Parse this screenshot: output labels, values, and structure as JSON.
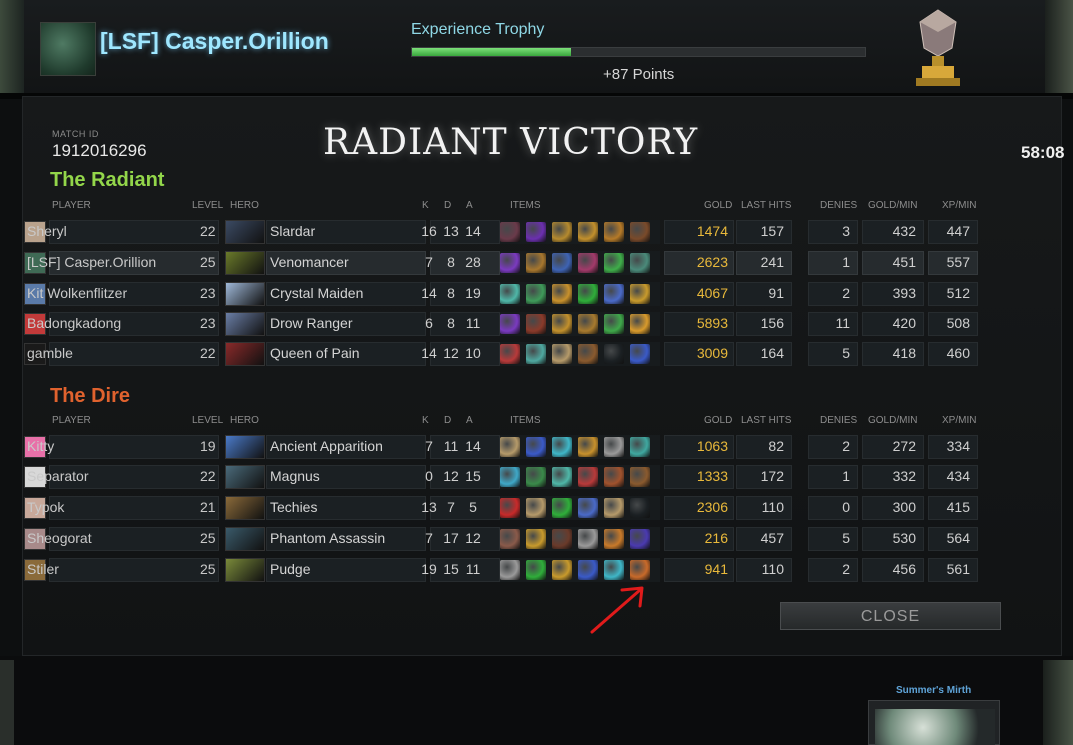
{
  "profile": {
    "player_name": "[LSF] Casper.Orillion",
    "xp_title": "Experience Trophy",
    "xp_progress_fraction": 0.35,
    "xp_points": "+87 Points"
  },
  "match": {
    "id_label": "MATCH ID",
    "id": "1912016296",
    "result": "RADIANT VICTORY",
    "duration": "58:08"
  },
  "headers": {
    "player": "PLAYER",
    "level": "LEVEL",
    "hero": "HERO",
    "k": "K",
    "d": "D",
    "a": "A",
    "items": "ITEMS",
    "gold": "GOLD",
    "last_hits": "LAST HITS",
    "denies": "DENIES",
    "gpm": "GOLD/MIN",
    "xpm": "XP/MIN"
  },
  "radiant": {
    "title": "The Radiant",
    "players": [
      {
        "name": "Sheryl",
        "level": "22",
        "hero": "Slardar",
        "k": "16",
        "d": "13",
        "a": "14",
        "gold": "1474",
        "lh": "157",
        "dn": "3",
        "gpm": "432",
        "xpm": "447",
        "avatar_color": "#b9a28c",
        "hero_color": "#3b4a63",
        "items": [
          "#6a3a4a",
          "#6b2fb0",
          "#b58a2e",
          "#c2902c",
          "#b57a28",
          "#7a4a2a"
        ]
      },
      {
        "name": "[LSF] Casper.Orillion",
        "level": "25",
        "hero": "Venomancer",
        "k": "7",
        "d": "8",
        "a": "28",
        "gold": "2623",
        "lh": "241",
        "dn": "1",
        "gpm": "451",
        "xpm": "557",
        "avatar_color": "#3f6a55",
        "hero_color": "#6a7a2a",
        "items": [
          "#7b3ac0",
          "#a7772e",
          "#3e63b3",
          "#a23a6a",
          "#3fae4a",
          "#4a8a7a"
        ]
      },
      {
        "name": "Kit Wolkenflitzer",
        "level": "23",
        "hero": "Crystal Maiden",
        "k": "14",
        "d": "8",
        "a": "19",
        "gold": "4067",
        "lh": "91",
        "dn": "2",
        "gpm": "393",
        "xpm": "512",
        "avatar_color": "#5a7aa8",
        "hero_color": "#9fb8d8",
        "items": [
          "#4fb7a8",
          "#3f9a5a",
          "#c8912c",
          "#2fae3a",
          "#4a6ac8",
          "#c89a2c"
        ]
      },
      {
        "name": "Badongkadong",
        "level": "23",
        "hero": "Drow Ranger",
        "k": "6",
        "d": "8",
        "a": "11",
        "gold": "5893",
        "lh": "156",
        "dn": "11",
        "gpm": "420",
        "xpm": "508",
        "avatar_color": "#c23a3a",
        "hero_color": "#6a7ea6",
        "items": [
          "#7a3ac0",
          "#8a3a2a",
          "#c2902c",
          "#a87a2e",
          "#3fa84a",
          "#d89a2c"
        ]
      },
      {
        "name": "gamble",
        "level": "22",
        "hero": "Queen of Pain",
        "k": "14",
        "d": "12",
        "a": "10",
        "gold": "3009",
        "lh": "164",
        "dn": "5",
        "gpm": "418",
        "xpm": "460",
        "avatar_color": "#1a1a1a",
        "hero_color": "#8a2a2a",
        "items": [
          "#b83a3a",
          "#4fa8a0",
          "#b59a6a",
          "#8a5a2e",
          "#1b2023",
          "#3a5ac8"
        ]
      }
    ]
  },
  "dire": {
    "title": "The Dire",
    "players": [
      {
        "name": "Kitty",
        "level": "19",
        "hero": "Ancient Apparition",
        "k": "7",
        "d": "11",
        "a": "14",
        "gold": "1063",
        "lh": "82",
        "dn": "2",
        "gpm": "272",
        "xpm": "334",
        "avatar_color": "#e870a8",
        "hero_color": "#4a7ac8",
        "items": [
          "#b59a6a",
          "#3a5ac8",
          "#3fb7c8",
          "#c8912c",
          "#9a9a9a",
          "#3fa8a0"
        ]
      },
      {
        "name": "Separator",
        "level": "22",
        "hero": "Magnus",
        "k": "0",
        "d": "12",
        "a": "15",
        "gold": "1333",
        "lh": "172",
        "dn": "1",
        "gpm": "332",
        "xpm": "434",
        "avatar_color": "#d8d8d8",
        "hero_color": "#4a6a7a",
        "items": [
          "#3fa8c8",
          "#3a8a4a",
          "#4fb7a8",
          "#b83a3a",
          "#a0522d",
          "#8a5a2e"
        ]
      },
      {
        "name": "Typok",
        "level": "21",
        "hero": "Techies",
        "k": "13",
        "d": "7",
        "a": "5",
        "gold": "2306",
        "lh": "110",
        "dn": "0",
        "gpm": "300",
        "xpm": "415",
        "avatar_color": "#c8a89a",
        "hero_color": "#8a6a3a",
        "items": [
          "#c82a2a",
          "#b59a6a",
          "#2fae3a",
          "#4a6ac8",
          "#b59a6a",
          "#1b2023"
        ]
      },
      {
        "name": "Sheogorat",
        "level": "25",
        "hero": "Phantom Assassin",
        "k": "7",
        "d": "17",
        "a": "12",
        "gold": "216",
        "lh": "457",
        "dn": "5",
        "gpm": "530",
        "xpm": "564",
        "avatar_color": "#a88a8a",
        "hero_color": "#3a5a6a",
        "items": [
          "#8a5a4a",
          "#c89a2c",
          "#6a3a2a",
          "#9a9a9a",
          "#c87a2a",
          "#4a3ab0"
        ]
      },
      {
        "name": "Stiler",
        "level": "25",
        "hero": "Pudge",
        "k": "19",
        "d": "15",
        "a": "11",
        "gold": "941",
        "lh": "110",
        "dn": "2",
        "gpm": "456",
        "xpm": "561",
        "avatar_color": "#8a6a3a",
        "hero_color": "#7a8a3a",
        "items": [
          "#9a9a9a",
          "#2fae3a",
          "#c89a2c",
          "#3a5ac8",
          "#3fb7c8",
          "#c86a2a"
        ]
      }
    ]
  },
  "close_label": "CLOSE",
  "bottom": {
    "mirth_label": "Summer's Mirth"
  },
  "colors": {
    "radiant": "#93d64a",
    "dire": "#e0622e",
    "gold": "#e9b93b",
    "accent_name": "#9fe7ff",
    "arrow": "#e01b1b"
  }
}
